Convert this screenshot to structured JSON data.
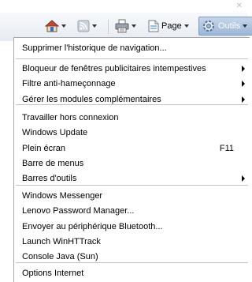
{
  "toolbar": {
    "page_label": "Page",
    "tools_label": "Outils"
  },
  "menu": {
    "groups": [
      [
        {
          "label": "Supprimer l'historique de navigation..."
        }
      ],
      [
        {
          "label": "Bloqueur de fenêtres publicitaires intempestives",
          "submenu": true
        },
        {
          "label": "Filtre anti-hameçonnage",
          "submenu": true
        },
        {
          "label": "Gérer les modules complémentaires",
          "submenu": true
        }
      ],
      [
        {
          "label": "Travailler hors connexion"
        },
        {
          "label": "Windows Update"
        },
        {
          "label": "Plein écran",
          "accel": "F11"
        },
        {
          "label": "Barre de menus"
        },
        {
          "label": "Barres d'outils",
          "submenu": true
        }
      ],
      [
        {
          "label": "Windows Messenger"
        },
        {
          "label": "Lenovo Password Manager..."
        },
        {
          "label": "Envoyer au périphérique Bluetooth..."
        },
        {
          "label": "Launch WinHTTrack"
        },
        {
          "label": "Console Java (Sun)"
        }
      ],
      [
        {
          "label": "Options Internet"
        }
      ]
    ]
  }
}
